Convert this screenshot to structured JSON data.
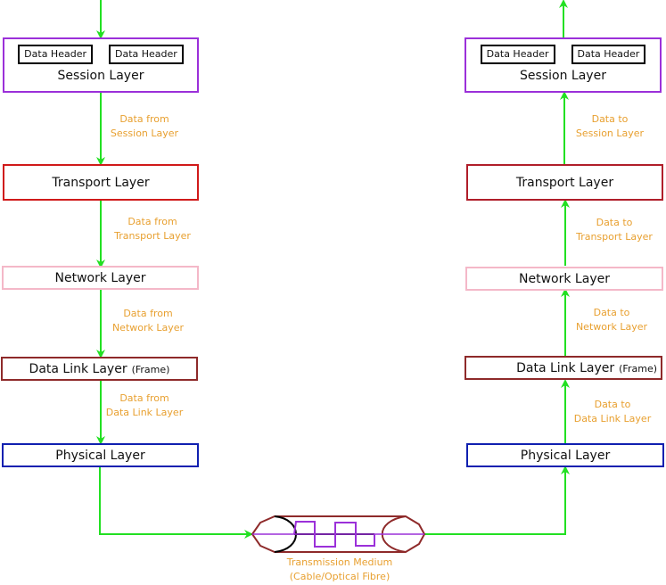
{
  "colors": {
    "arrow": "#22e022",
    "label": "#e8a030",
    "session_border": "#9b30d9",
    "transport_border": "#d01a1a",
    "network_border": "#f4b8c8",
    "datalink_border": "#8e2a2a",
    "physical_border": "#1020b0",
    "medium_outline": "#8e2a2a",
    "signal": "#9b30d9"
  },
  "sender": {
    "session": {
      "headers": [
        "Data Header",
        "Data Header"
      ],
      "title": "Session Layer"
    },
    "transport": {
      "title": "Transport Layer"
    },
    "network": {
      "title": "Network Layer"
    },
    "datalink": {
      "title": "Data Link Layer",
      "sub": "(Frame)"
    },
    "physical": {
      "title": "Physical Layer"
    },
    "labels": [
      [
        "Data from",
        "Session Layer"
      ],
      [
        "Data from",
        "Transport Layer"
      ],
      [
        "Data from",
        "Network Layer"
      ],
      [
        "Data from",
        "Data Link Layer"
      ]
    ]
  },
  "receiver": {
    "session": {
      "headers": [
        "Data Header",
        "Data Header"
      ],
      "title": "Session Layer"
    },
    "transport": {
      "title": "Transport Layer"
    },
    "network": {
      "title": "Network Layer"
    },
    "datalink": {
      "title": "Data Link Layer",
      "sub": "(Frame)"
    },
    "physical": {
      "title": "Physical Layer"
    },
    "labels": [
      [
        "Data to",
        "Session Layer"
      ],
      [
        "Data to",
        "Transport Layer"
      ],
      [
        "Data to",
        "Network Layer"
      ],
      [
        "Data to",
        "Data Link Layer"
      ]
    ]
  },
  "medium": {
    "line1": "Transmission Medium",
    "line2": "(Cable/Optical Fibre)"
  }
}
